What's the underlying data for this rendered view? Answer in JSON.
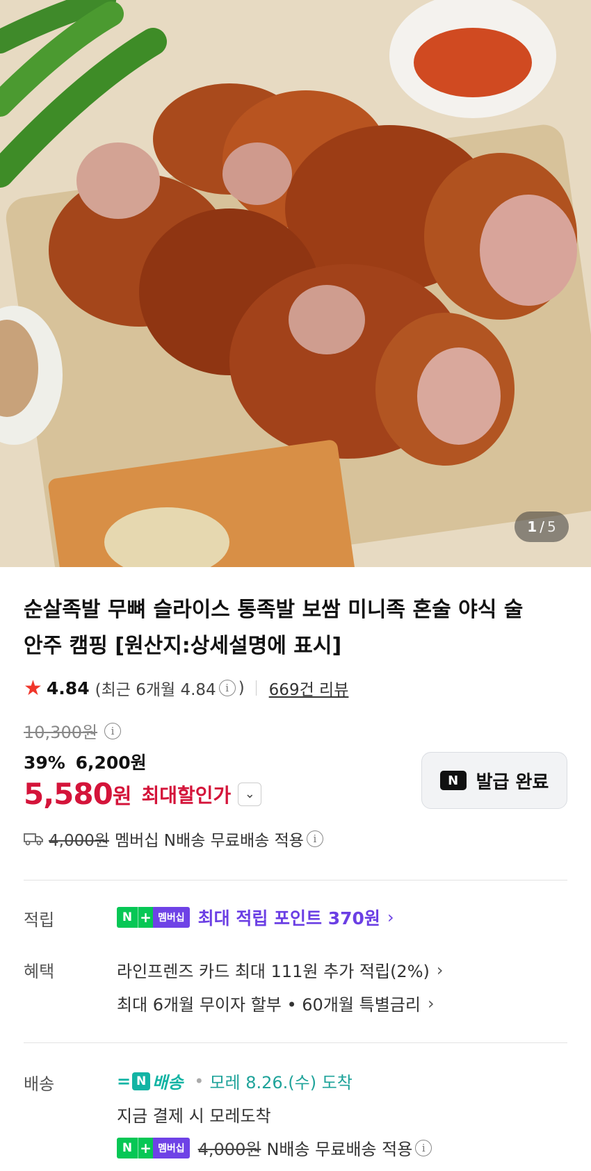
{
  "image": {
    "counter_current": "1",
    "counter_sep": "/",
    "counter_total": "5"
  },
  "product": {
    "title": "순살족발 무뼈 슬라이스 통족발 보쌈 미니족 혼술 야식 술안주 캠핑 [원산지:상세설명에 표시]"
  },
  "rating": {
    "score": "4.84",
    "recent_open": "(최근 6개월 4.84",
    "recent_close": ")",
    "reviews": "669건 리뷰"
  },
  "price": {
    "original": "10,300원",
    "discount_rate": "39%",
    "discount_price": "6,200원",
    "max_price_num": "5,580",
    "max_price_won": "원",
    "max_label": "최대할인가"
  },
  "coupon": {
    "icon": "N",
    "label": "발급 완료"
  },
  "shipping_line": {
    "strike_fee": "4,000원",
    "text": "멤버십 N배송 무료배송 적용"
  },
  "rows": {
    "points_label": "적립",
    "badge_n": "N",
    "badge_plus": "+",
    "badge_member": "멤버십",
    "points_text": "최대 적립 포인트 370원",
    "benefit_label": "혜택",
    "benefit_1": "라인프렌즈 카드 최대 111원 추가 적립(2%)",
    "benefit_2": "최대 6개월 무이자 할부 • 60개월 특별금리",
    "delivery_label": "배송",
    "nship_n": "N",
    "nship_text": "배송",
    "delivery_date": "모레 8.26.(수) 도착",
    "delivery_note": "지금 결제 시 모레도착",
    "delivery_fee_strike": "4,000원",
    "delivery_fee_text": "N배송 무료배송 적용"
  },
  "colors": {
    "accent_red": "#d4143a",
    "purple": "#6b3fe4",
    "teal": "#12b4a4",
    "naver_green": "#06c755"
  },
  "icons": [
    "star-icon",
    "info-icon",
    "chevron-down-icon",
    "truck-icon",
    "chevron-right-icon",
    "naver-n-icon"
  ]
}
